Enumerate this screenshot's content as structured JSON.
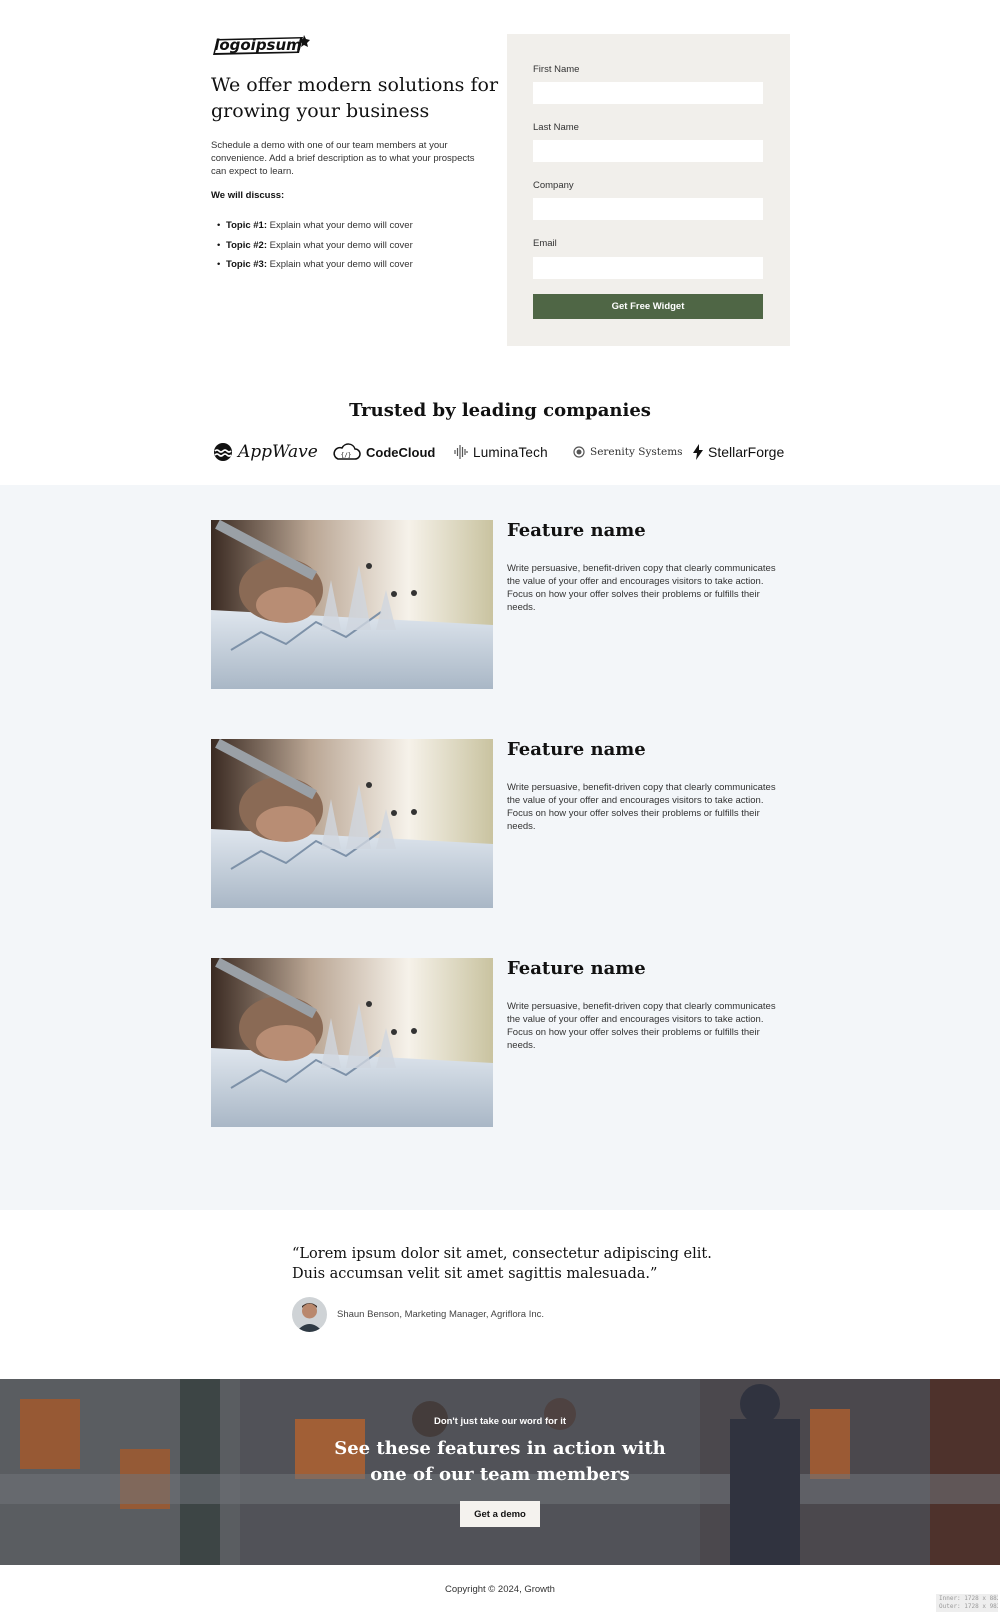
{
  "hero": {
    "logo_text": "logoipsum",
    "title": "We offer modern solutions for growing your business",
    "description": "Schedule a demo with one of our team members at your convenience. Add a brief description as to what your prospects can expect to learn.",
    "discuss_label": "We will discuss:",
    "topics": [
      {
        "label": "Topic #1:",
        "text": "Explain what your demo will cover"
      },
      {
        "label": "Topic #2:",
        "text": "Explain what your demo will cover"
      },
      {
        "label": "Topic #3:",
        "text": "Explain what your demo will cover"
      }
    ]
  },
  "form": {
    "fields": [
      {
        "label": "First Name",
        "value": "",
        "placeholder": ""
      },
      {
        "label": "Last Name",
        "value": "",
        "placeholder": ""
      },
      {
        "label": "Company",
        "value": "",
        "placeholder": ""
      },
      {
        "label": "Email",
        "value": "",
        "placeholder": ""
      }
    ],
    "submit_label": "Get Free Widget",
    "submit_color": "#4f6645",
    "card_color": "#f1efeb"
  },
  "trusted": {
    "title": "Trusted by leading companies",
    "brands": [
      {
        "name": "AppWave",
        "icon": "wave-icon"
      },
      {
        "name": "CodeCloud",
        "icon": "cloud-code-icon"
      },
      {
        "name": "LuminaTech",
        "icon": "soundwave-icon"
      },
      {
        "name": "Serenity Systems",
        "icon": "circle-dot-icon"
      },
      {
        "name": "StellarForge",
        "icon": "bolt-icon"
      }
    ]
  },
  "features": [
    {
      "title": "Feature name",
      "text": "Write persuasive, benefit-driven copy that clearly communicates the value of your offer and encourages visitors to take action. Focus on how your offer solves their problems or fulfills their needs."
    },
    {
      "title": "Feature name",
      "text": "Write persuasive, benefit-driven copy that clearly communicates the value of your offer and encourages visitors to take action. Focus on how your offer solves their problems or fulfills their needs."
    },
    {
      "title": "Feature name",
      "text": "Write persuasive, benefit-driven copy that clearly communicates the value of your offer and encourages visitors to take action. Focus on how your offer solves their problems or fulfills their needs."
    }
  ],
  "testimonial": {
    "quote": "“Lorem ipsum dolor sit amet, consectetur adipiscing elit. Duis accumsan velit sit amet sagittis malesuada.”",
    "author": "Shaun Benson, Marketing Manager, Agriflora Inc."
  },
  "cta": {
    "eyebrow": "Don't just take our word for it",
    "title": "See these features in action with one of our team members",
    "button_label": "Get a demo"
  },
  "footer": {
    "copyright": "Copyright © 2024, Growth",
    "badge_line1": "Inner: 1728 x 882",
    "badge_line2": "Outer: 1728 x 983"
  },
  "colors": {
    "feature_bg": "#f3f6f9",
    "cta_accent": "#d9722f"
  }
}
